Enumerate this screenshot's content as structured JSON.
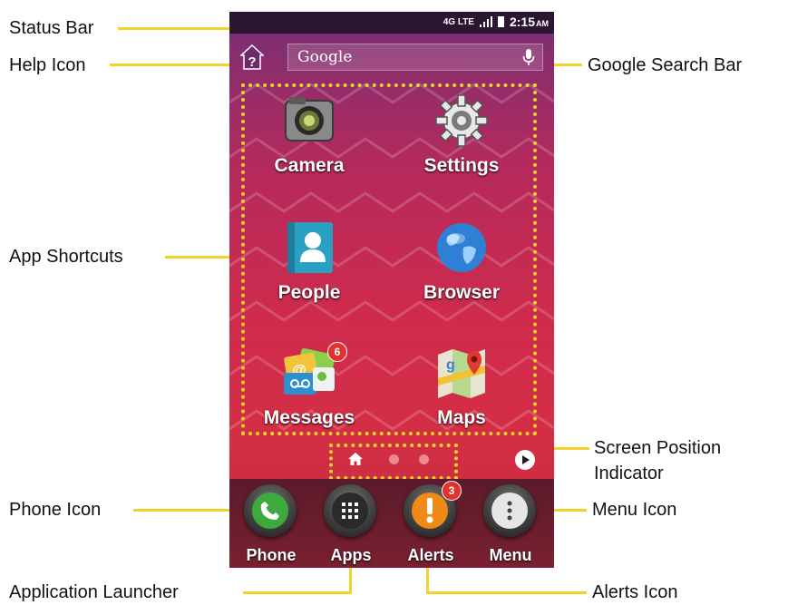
{
  "callouts": {
    "status_bar": "Status Bar",
    "help_icon": "Help Icon",
    "google_search_bar": "Google Search Bar",
    "app_shortcuts": "App Shortcuts",
    "screen_position_indicator": "Screen Position Indicator",
    "phone_icon": "Phone Icon",
    "menu_icon": "Menu Icon",
    "application_launcher": "Application Launcher",
    "alerts_icon": "Alerts Icon"
  },
  "status": {
    "network": "4G LTE",
    "time": "2:15",
    "ampm": "AM"
  },
  "search": {
    "label": "Google"
  },
  "apps": [
    {
      "label": "Camera",
      "icon": "camera-icon"
    },
    {
      "label": "Settings",
      "icon": "gear-icon"
    },
    {
      "label": "People",
      "icon": "contact-icon"
    },
    {
      "label": "Browser",
      "icon": "globe-icon"
    },
    {
      "label": "Messages",
      "icon": "messages-icon",
      "badge": "6"
    },
    {
      "label": "Maps",
      "icon": "map-icon"
    }
  ],
  "dock": [
    {
      "label": "Phone",
      "icon": "phone-icon"
    },
    {
      "label": "Apps",
      "icon": "grid-icon"
    },
    {
      "label": "Alerts",
      "icon": "alert-icon",
      "badge": "3"
    },
    {
      "label": "Menu",
      "icon": "menu-icon"
    }
  ],
  "colors": {
    "callout_line": "#f2d32b",
    "status_bar": "#2b1632",
    "phone_green": "#3daa3d",
    "alerts_orange": "#f08a17"
  }
}
